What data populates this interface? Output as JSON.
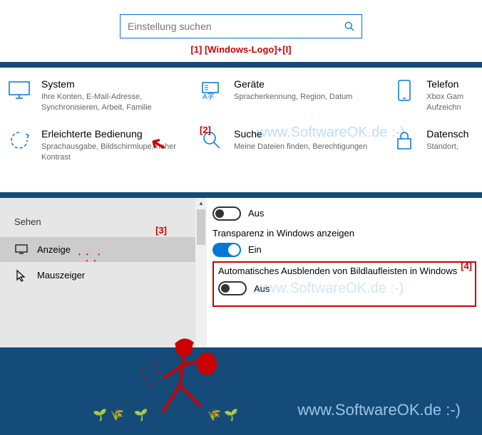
{
  "search": {
    "placeholder": "Einstellung suchen"
  },
  "annotations": {
    "a1": "[1]  [Windows-Logo]+[I]",
    "a2": "[2]",
    "a3": "[3]",
    "a4": "[4]"
  },
  "tiles": {
    "system": {
      "title": "System",
      "desc": "Ihre Konten, E-Mail-Adresse, Synchronisieren, Arbeit, Familie"
    },
    "geraete": {
      "title": "Geräte",
      "desc": "Spracherkennung, Region, Datum"
    },
    "telefon": {
      "title": "Telefon",
      "desc": "Xbox Gam\nAufzeichn"
    },
    "erleichterte": {
      "title": "Erleichterte Bedienung",
      "desc": "Sprachausgabe, Bildschirmlupe, hoher Kontrast"
    },
    "suche": {
      "title": "Suche",
      "desc": "Meine Dateien finden, Berechtigungen"
    },
    "datenschutz": {
      "title": "Datensch",
      "desc": "Standort, "
    }
  },
  "sidebar": {
    "header": "Sehen",
    "items": [
      {
        "label": "Anzeige"
      },
      {
        "label": "Mauszeiger"
      }
    ]
  },
  "content": {
    "off1": "Aus",
    "transparency_title": "Transparenz in Windows anzeigen",
    "on": "Ein",
    "scrollbar_title": "Automatisches Ausblenden von Bildlaufleisten in Windows",
    "off2": "Aus"
  },
  "watermark": "www.SoftwareOK.de :-)"
}
